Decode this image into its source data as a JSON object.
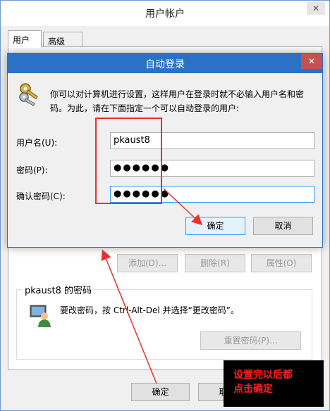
{
  "outer_dialog": {
    "title": "用户帐户",
    "tabs": [
      {
        "label": "用户",
        "active": true
      },
      {
        "label": "高级",
        "active": false
      }
    ],
    "buttons": {
      "add": "添加(D)...",
      "remove": "删除(R)",
      "properties": "属性(O)"
    },
    "password_group": {
      "title": "pkaust8 的密码",
      "hint": "要改密码，按 Ctrl-Alt-Del 并选择“更改密码”。",
      "reset_button": "重置密码(P)..."
    },
    "ok_button": "确定",
    "cancel_button": "取消"
  },
  "auto_logon_dialog": {
    "title": "自动登录",
    "close_glyph": "✕",
    "description_line1": "你可以对计算机进行设置，这样用户在登录时就不必输入用户名和密",
    "description_line2": "码。为此，请在下面指定一个可以自动登录的用户:",
    "fields": {
      "username_label": "用户名(U):",
      "username_value": "pkaust8",
      "password_label": "密码(P):",
      "password_value": "●●●●●●",
      "confirm_label": "确认密码(C):",
      "confirm_value": "●●●●●●"
    },
    "ok_button": "确定",
    "cancel_button": "取消"
  },
  "annotation": {
    "note_line1": "设置完以后都",
    "note_line2": "点击确定",
    "color": "#e8312f"
  },
  "colors": {
    "titlebar_active": "#2b72c6",
    "close_red": "#c75050",
    "focus_blue": "#3399ff"
  },
  "icons": [
    "keys-icon",
    "user-password-icon",
    "close-icon"
  ]
}
